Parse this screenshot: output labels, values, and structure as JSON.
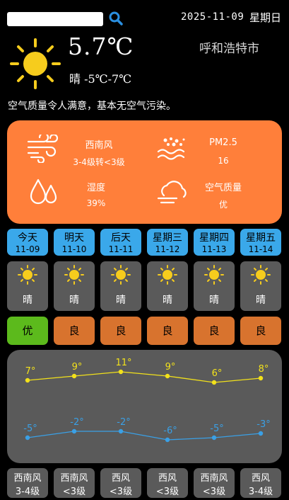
{
  "search": {
    "value": "",
    "placeholder": ""
  },
  "header": {
    "date": "2025-11-09",
    "weekday": "星期日",
    "city": "呼和浩特市"
  },
  "current": {
    "temperature": "5.7℃",
    "condition_range": "晴 -5℃-7℃",
    "air_desc": "空气质量令人满意，基本无空气污染。",
    "icon": "sun-icon"
  },
  "details": {
    "wind_dir": "西南风",
    "wind_level": "3-4级转<3级",
    "pm25_label": "PM2.5",
    "pm25_value": "16",
    "humidity_label": "湿度",
    "humidity_value": "39%",
    "aq_label": "空气质量",
    "aq_value": "优"
  },
  "days": [
    {
      "name": "今天",
      "date": "11-09",
      "cond": "晴",
      "aq": "优",
      "aq_level": "good",
      "high": "7°",
      "low": "-5°",
      "wind_dir": "西南风",
      "wind_lvl": "3-4级"
    },
    {
      "name": "明天",
      "date": "11-10",
      "cond": "晴",
      "aq": "良",
      "aq_level": "moderate",
      "high": "9°",
      "low": "-2°",
      "wind_dir": "西南风",
      "wind_lvl": "<3级"
    },
    {
      "name": "后天",
      "date": "11-11",
      "cond": "晴",
      "aq": "良",
      "aq_level": "moderate",
      "high": "11°",
      "low": "-2°",
      "wind_dir": "西风",
      "wind_lvl": "<3级"
    },
    {
      "name": "星期三",
      "date": "11-12",
      "cond": "晴",
      "aq": "良",
      "aq_level": "moderate",
      "high": "9°",
      "low": "-6°",
      "wind_dir": "西风",
      "wind_lvl": "<3级"
    },
    {
      "name": "星期四",
      "date": "11-13",
      "cond": "晴",
      "aq": "良",
      "aq_level": "moderate",
      "high": "6°",
      "low": "-5°",
      "wind_dir": "西南风",
      "wind_lvl": "<3级"
    },
    {
      "name": "星期五",
      "date": "11-14",
      "cond": "晴",
      "aq": "良",
      "aq_level": "moderate",
      "high": "8°",
      "low": "-3°",
      "wind_dir": "西风",
      "wind_lvl": "3-4级"
    }
  ],
  "chart_data": {
    "type": "line",
    "categories": [
      "11-09",
      "11-10",
      "11-11",
      "11-12",
      "11-13",
      "11-14"
    ],
    "series": [
      {
        "values": [
          7,
          9,
          11,
          9,
          6,
          8
        ],
        "color": "#f2e11b"
      },
      {
        "values": [
          -5,
          -2,
          -2,
          -6,
          -5,
          -3
        ],
        "color": "#3aa0e6"
      }
    ]
  },
  "colors": {
    "accent_orange": "#ff7f3a",
    "tab_blue": "#3aa8ea",
    "aq_good": "#5cba1c",
    "aq_moderate": "#d8732e",
    "sun_yellow": "#f6cc1d",
    "high_line": "#f2e11b",
    "low_line": "#3aa0e6"
  },
  "icons": {
    "search": "search-icon",
    "wind": "wind-icon",
    "pm25": "pm25-icon",
    "humidity": "humidity-icon",
    "air_quality": "cloud-icon"
  }
}
